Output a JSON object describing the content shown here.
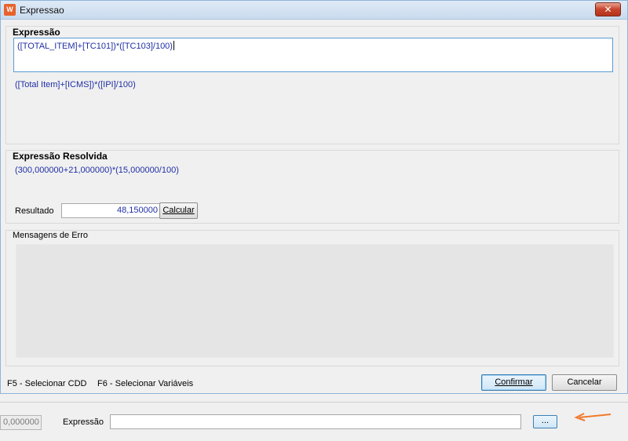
{
  "window": {
    "title": "Expressao",
    "app_icon_glyph": "W",
    "close_glyph": "✕"
  },
  "expression_group": {
    "title": "Expressão",
    "input_value": "([TOTAL_ITEM]+[TC101])*([TC103]/100)",
    "description": "([Total Item]+[ICMS])*([IPI]/100)"
  },
  "resolved_group": {
    "title": "Expressão Resolvida",
    "resolved_expression": "(300,000000+21,000000)*(15,000000/100)",
    "result_label": "Resultado",
    "result_value": "48,150000",
    "calculate_label": "Calcular"
  },
  "errors_group": {
    "title": "Mensagens de Erro"
  },
  "shortcuts": {
    "f5": "F5 - Selecionar CDD",
    "f6": "F6 - Selecionar Variáveis"
  },
  "actions": {
    "confirm_label": "Confirmar",
    "cancel_label": "Cancelar"
  },
  "background_form": {
    "number_value": "0,000000",
    "expression_label": "Expressão",
    "expression_value": "",
    "browse_label": "..."
  },
  "colors": {
    "expression_text": "#1f2fa5",
    "arrow": "#f07a2a",
    "close_button": "#c7432a"
  }
}
